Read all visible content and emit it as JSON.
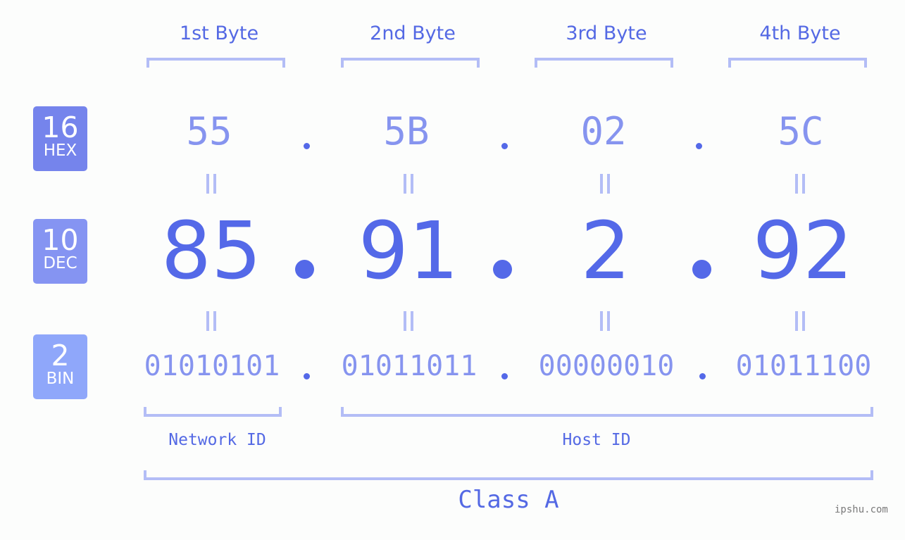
{
  "bytes": [
    {
      "label": "1st Byte",
      "hex": "55",
      "dec": "85",
      "bin": "01010101"
    },
    {
      "label": "2nd Byte",
      "hex": "5B",
      "dec": "91",
      "bin": "01011011"
    },
    {
      "label": "3rd Byte",
      "hex": "02",
      "dec": "2",
      "bin": "00000010"
    },
    {
      "label": "4th Byte",
      "hex": "5C",
      "dec": "92",
      "bin": "01011100"
    }
  ],
  "badges": {
    "hex": {
      "base": "16",
      "name": "HEX",
      "color": "#7584ec"
    },
    "dec": {
      "base": "10",
      "name": "DEC",
      "color": "#8594f2"
    },
    "bin": {
      "base": "2",
      "name": "BIN",
      "color": "#8fa7fa"
    }
  },
  "segments": {
    "network": "Network ID",
    "host": "Host ID",
    "class": "Class A"
  },
  "colors": {
    "accent": "#5469e8",
    "light_value": "#8694ef",
    "bracket": "#b3bdf6"
  },
  "watermark": "ipshu.com"
}
